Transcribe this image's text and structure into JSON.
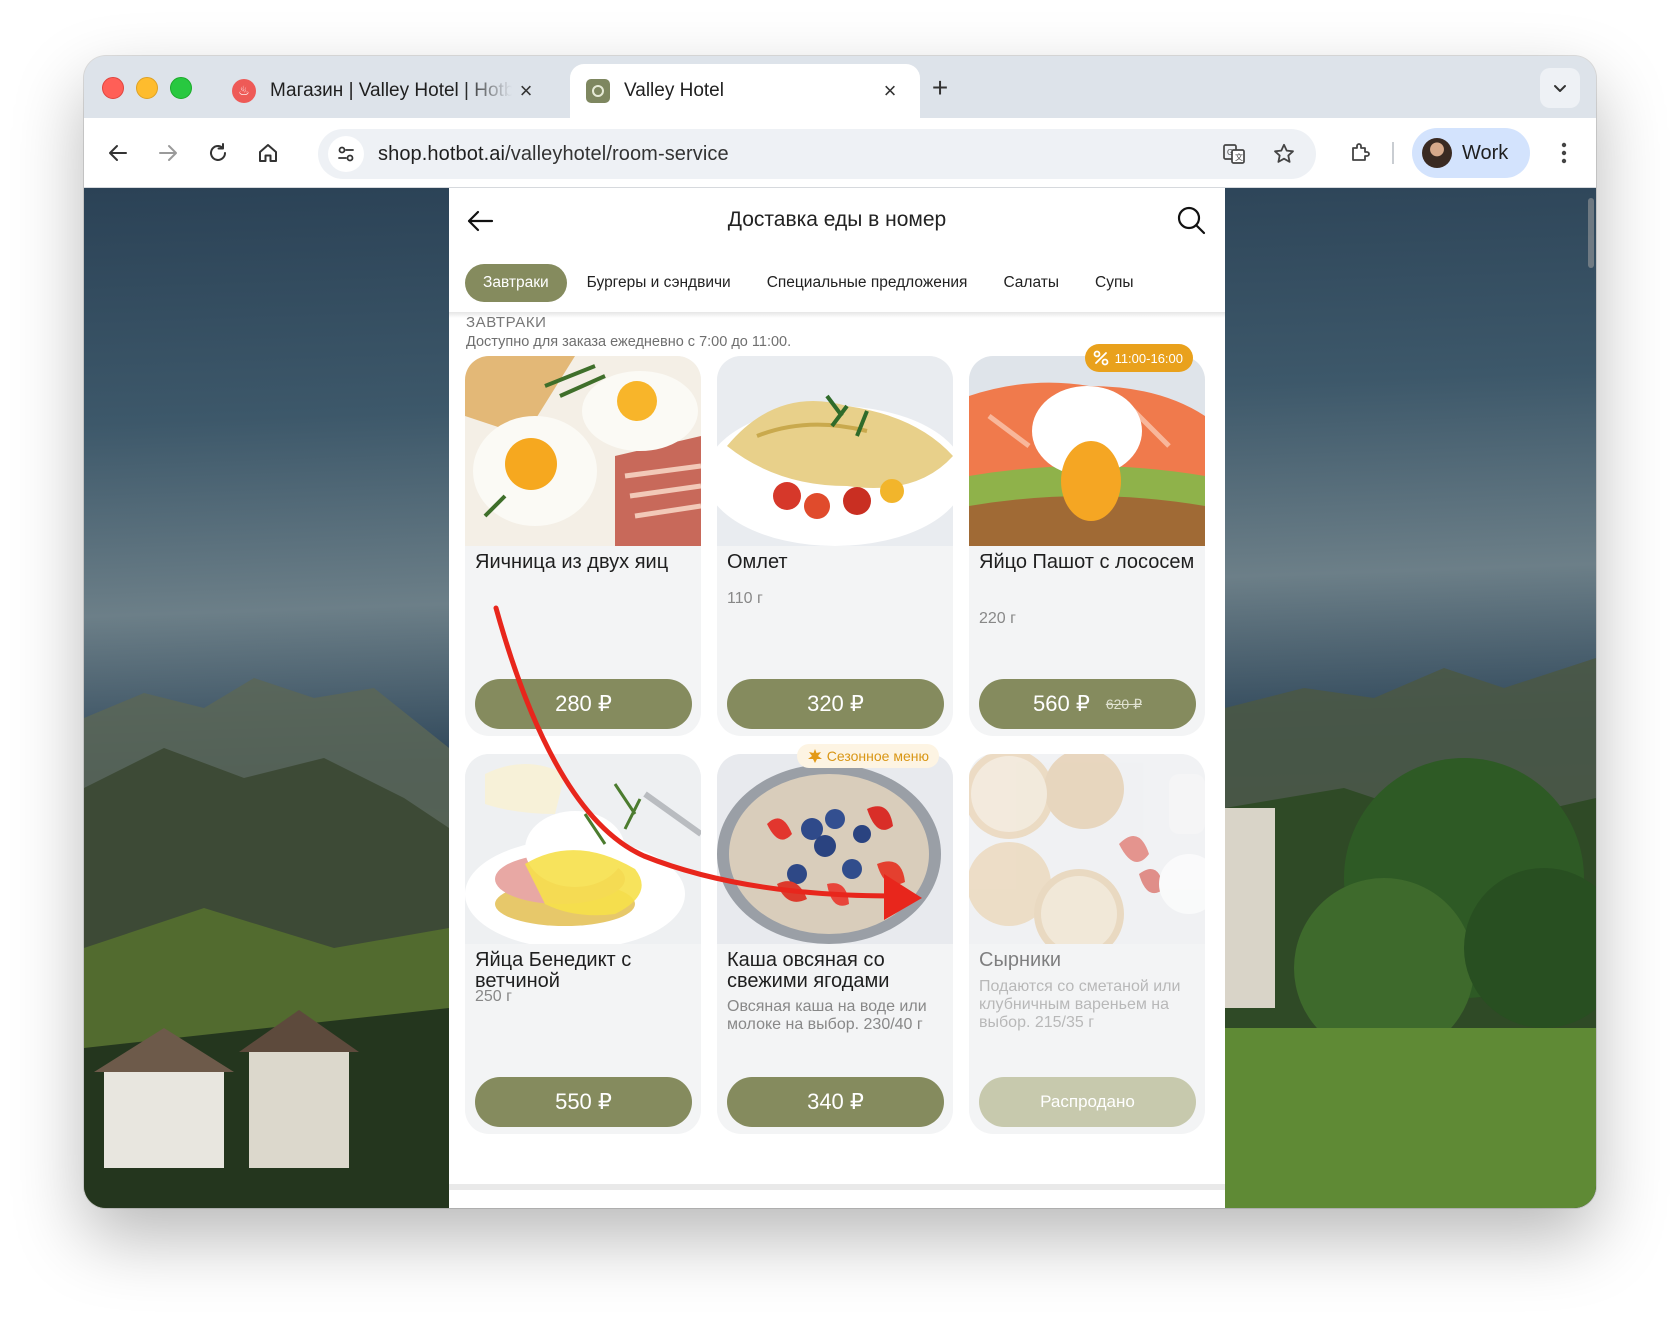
{
  "browser": {
    "tabs": [
      {
        "title": "Магазин | Valley Hotel | Hotbot",
        "active": false
      },
      {
        "title": "Valley Hotel",
        "active": true
      }
    ],
    "url_host": "shop.hotbot.ai",
    "url_path": "/valleyhotel/room-service",
    "profile_label": "Work"
  },
  "page": {
    "title": "Доставка еды в номер",
    "categories": [
      {
        "label": "Завтраки",
        "active": true
      },
      {
        "label": "Бургеры и сэндвичи",
        "active": false
      },
      {
        "label": "Специальные предложения",
        "active": false
      },
      {
        "label": "Салаты",
        "active": false
      },
      {
        "label": "Супы",
        "active": false
      }
    ],
    "section": {
      "title": "ЗАВТРАКИ",
      "subtitle": "Доступно для заказа ежедневно с 7:00 до 11:00."
    },
    "items": [
      {
        "name": "Яичница из двух яиц",
        "weight": "",
        "description": "",
        "price": "280 ₽",
        "old_price": "",
        "badge": "",
        "status": "available"
      },
      {
        "name": "Омлет",
        "weight": "110 г",
        "description": "",
        "price": "320 ₽",
        "old_price": "",
        "badge": "",
        "status": "available"
      },
      {
        "name": "Яйцо Пашот с лососем",
        "weight": "220 г",
        "description": "",
        "price": "560 ₽",
        "old_price": "620 ₽",
        "badge": "11:00-16:00",
        "status": "available"
      },
      {
        "name": "Яйца Бенедикт с ветчиной",
        "weight": "250 г",
        "description": "",
        "price": "550 ₽",
        "old_price": "",
        "badge": "",
        "status": "available"
      },
      {
        "name": "Каша овсяная со свежими ягодами",
        "weight": "",
        "description": "Овсяная каша на воде или молоке на выбор. 230/40 г",
        "price": "340 ₽",
        "old_price": "",
        "badge": "Сезонное меню",
        "status": "available"
      },
      {
        "name": "Сырники",
        "weight": "",
        "description": "Подаются со сметаной или клубничным вареньем на выбор. 215/35 г",
        "price": "Распродано",
        "old_price": "",
        "badge": "",
        "status": "sold_out"
      }
    ]
  },
  "colors": {
    "accent": "#858b5e",
    "sold_out": "#c7c9ad",
    "badge_orange": "#e9a11c",
    "annotation_arrow": "#e8261c"
  },
  "icons": [
    "back-arrow-icon",
    "forward-arrow-icon",
    "reload-icon",
    "home-icon",
    "site-settings-icon",
    "translate-icon",
    "bookmark-star-icon",
    "extensions-icon",
    "kebab-menu-icon",
    "search-icon",
    "percent-icon",
    "leaf-icon",
    "chevron-down-icon",
    "close-icon",
    "plus-icon"
  ]
}
